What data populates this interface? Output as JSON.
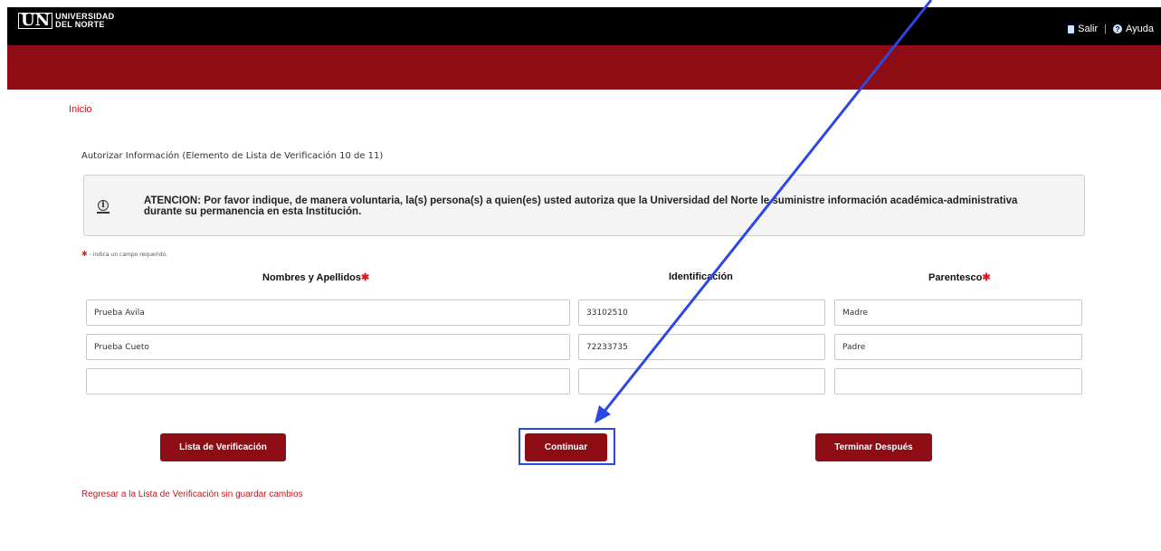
{
  "header": {
    "logo_mark": "UN",
    "logo_line1": "UNIVERSIDAD",
    "logo_line2": "DEL NORTE",
    "salir": "Salir",
    "separator": "|",
    "ayuda": "Ayuda"
  },
  "breadcrumb": "Inicio",
  "step_title": "Autorizar Información (Elemento de Lista de Verificación 10 de 11)",
  "notice": {
    "text": "ATENCION: Por favor indique, de manera voluntaria, la(s) persona(s) a quien(es) usted autoriza que la Universidad del Norte le suministre información académica-administrativa durante su permanencia en esta Institución."
  },
  "required_note": {
    "star": "✱",
    "text": " - indica un campo requerido."
  },
  "columns": {
    "nombres": "Nombres y Apellidos",
    "identificacion": "Identificación",
    "parentesco": "Parentesco",
    "star": "✱"
  },
  "rows": [
    {
      "nombre": "Prueba Avila",
      "identificacion": "33102510",
      "parentesco": "Madre"
    },
    {
      "nombre": "Prueba Cueto",
      "identificacion": "72233735",
      "parentesco": "Padre"
    },
    {
      "nombre": "",
      "identificacion": "",
      "parentesco": ""
    }
  ],
  "buttons": {
    "lista": "Lista de Verificación",
    "continuar": "Continuar",
    "terminar": "Terminar Después"
  },
  "back_link": "Regresar a la Lista de Verificación sin guardar cambios",
  "colors": {
    "brand_red": "#8e0c14",
    "annotation_blue": "#2b47e6"
  }
}
